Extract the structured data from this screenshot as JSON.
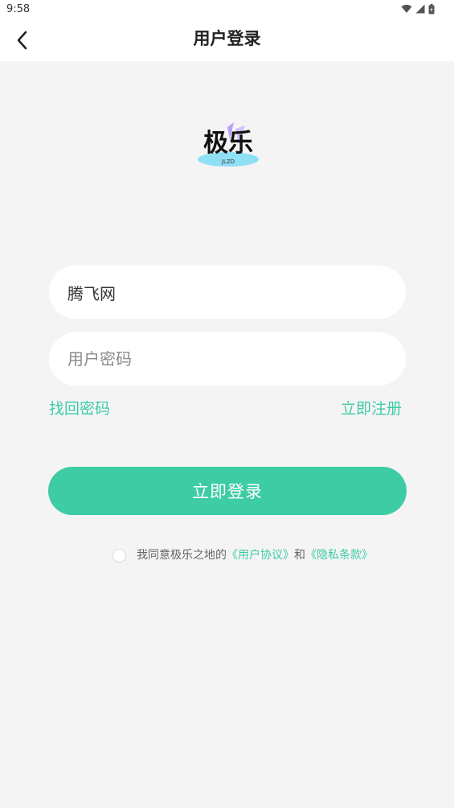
{
  "status_bar": {
    "time": "9:58",
    "icons": [
      "wifi-icon",
      "signal-icon",
      "battery-icon"
    ]
  },
  "app_bar": {
    "back_icon": "chevron-left-icon",
    "title": "用户登录"
  },
  "logo": {
    "main_text": "极乐",
    "sub_text": "JLZD"
  },
  "form": {
    "username_value": "腾飞网",
    "password_placeholder": "用户密码"
  },
  "links": {
    "forgot_password": "找回密码",
    "register": "立即注册"
  },
  "login_button": "立即登录",
  "agreement": {
    "prefix": "我同意极乐之地的",
    "user_agreement": "《用户协议》",
    "conjunction": "和",
    "privacy_policy": "《隐私条款》",
    "checked": false
  },
  "colors": {
    "accent": "#3ecca5",
    "background": "#f4f4f4",
    "surface": "#ffffff"
  }
}
